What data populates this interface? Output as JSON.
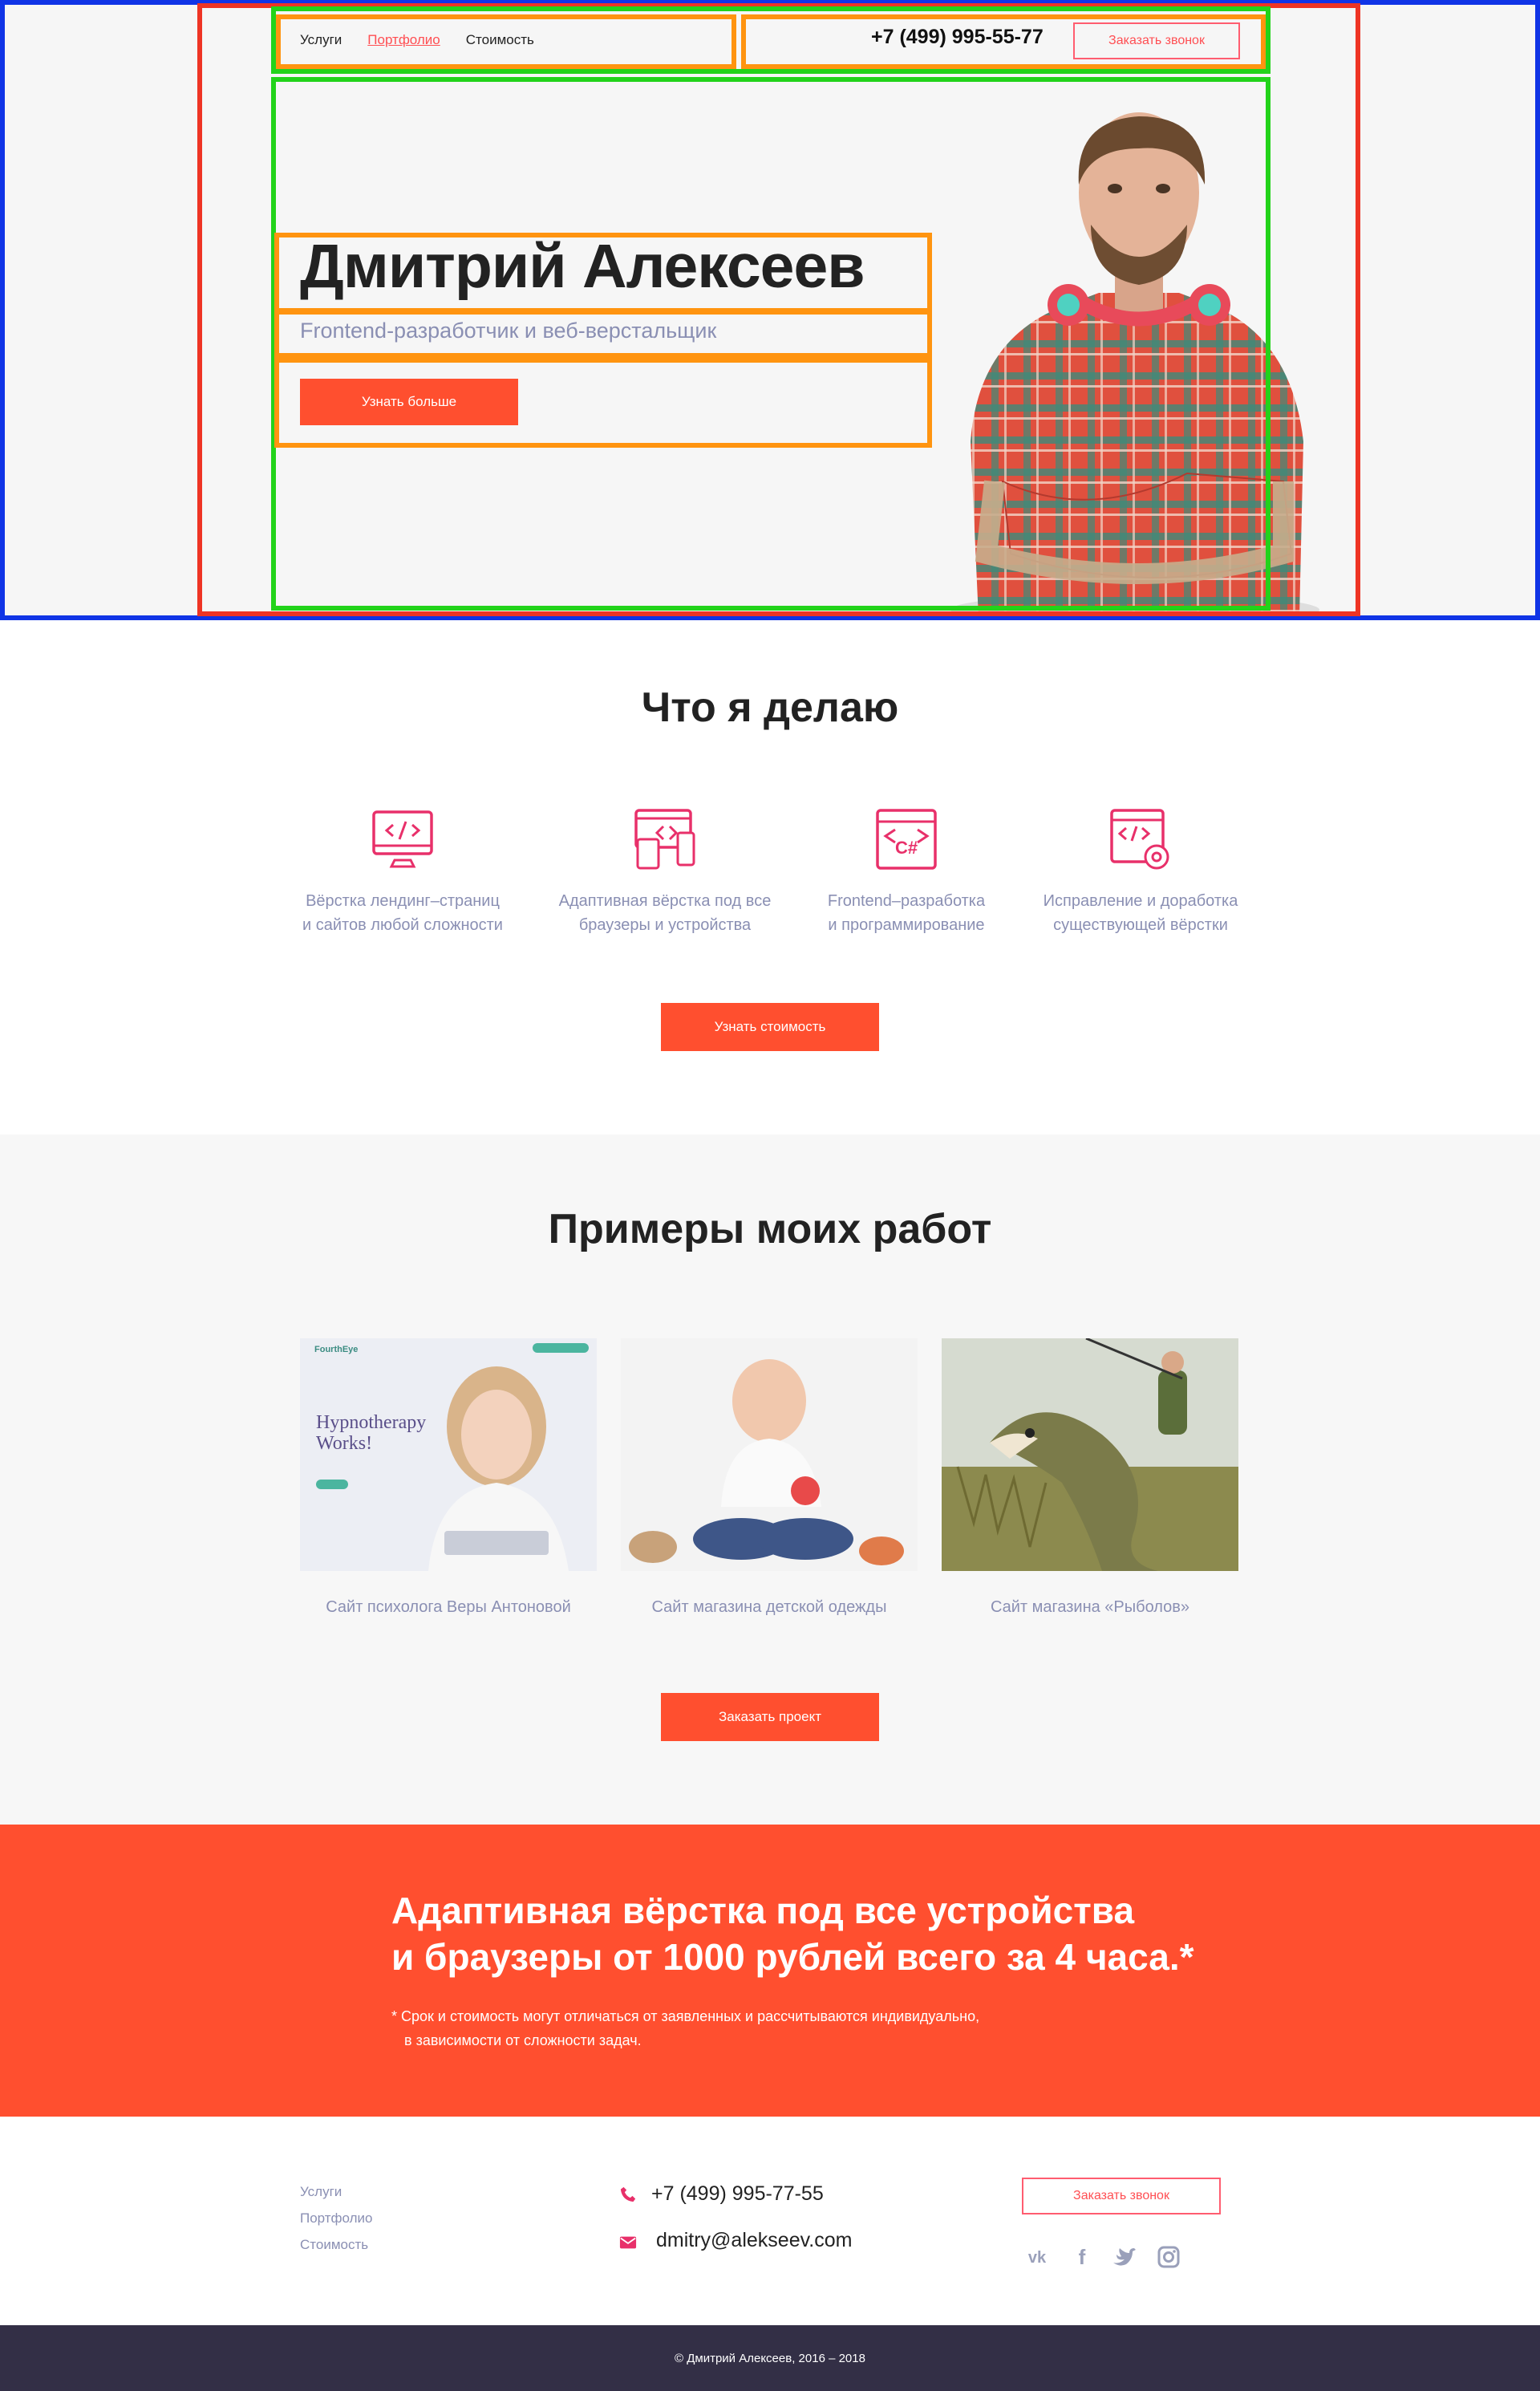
{
  "header": {
    "nav": [
      "Услуги",
      "Портфолио",
      "Стоимость"
    ],
    "active_nav": "Портфолио",
    "phone": "+7 (499) 995-55-77",
    "call_button": "Заказать звонок"
  },
  "hero": {
    "name": "Дмитрий Алексеев",
    "subtitle": "Frontend-разработчик и веб-верстальщик",
    "button": "Узнать больше"
  },
  "services": {
    "title": "Что я делаю",
    "items": [
      {
        "line1": "Вёрстка лендинг–страниц",
        "line2": "и сайтов любой сложности",
        "icon": "monitor-code-icon"
      },
      {
        "line1": "Адаптивная вёрстка под все",
        "line2": "браузеры и устройства",
        "icon": "devices-icon"
      },
      {
        "line1": "Frontend–разработка",
        "line2": "и программирование",
        "icon": "csharp-window-icon"
      },
      {
        "line1": "Исправление и доработка",
        "line2": "существующей вёрстки",
        "icon": "code-settings-icon"
      }
    ],
    "button": "Узнать стоимость"
  },
  "works": {
    "title": "Примеры моих работ",
    "items": [
      {
        "caption": "Сайт психолога Веры Антоновой",
        "thumb_heading": "Hypnotherapy Works!",
        "thumb_logo": "FourthEye"
      },
      {
        "caption": "Сайт магазина детской одежды"
      },
      {
        "caption": "Сайт магазина «Рыболов»"
      }
    ],
    "button": "Заказать проект"
  },
  "promo": {
    "heading_line1": "Адаптивная вёрстка под все устройства",
    "heading_line2": "и браузеры от 1000 рублей всего за 4 часа.*",
    "note_line1": "* Срок и стоимость могут отличаться от заявленных и рассчитываются  индивидуально,",
    "note_line2": "в зависимости от сложности задач."
  },
  "footer": {
    "links": [
      "Услуги",
      "Портфолио",
      "Стоимость"
    ],
    "phone": "+7 (499) 995-77-55",
    "email": "dmitry@alekseev.com",
    "call_button": "Заказать звонок",
    "social": [
      "vk-icon",
      "facebook-icon",
      "twitter-icon",
      "instagram-icon"
    ],
    "copyright": "© Дмитрий Алексеев, 2016 – 2018"
  },
  "colors": {
    "accent": "#ff4f2f",
    "link_active": "#ff4f53",
    "muted_text": "#8a8fb3",
    "footer_bar": "#332f46",
    "frame_blue": "#1034e6",
    "frame_red": "#ee3424",
    "frame_green": "#22d31a",
    "frame_orange": "#ff9410"
  }
}
